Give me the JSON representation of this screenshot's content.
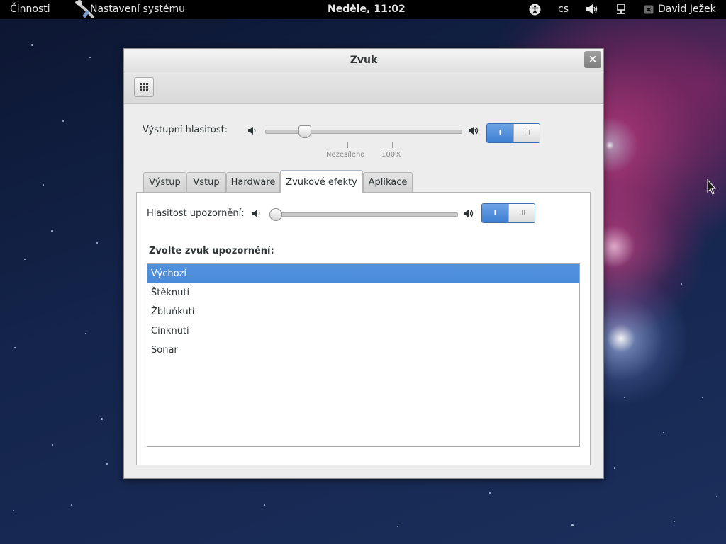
{
  "topbar": {
    "activities": "Činnosti",
    "app_name": "Nastavení systému",
    "clock": "Neděle, 11:02",
    "language": "cs",
    "user": "David Ježek",
    "icons": [
      "accessibility-icon",
      "volume-icon",
      "network-icon",
      "user-status-icon"
    ]
  },
  "window": {
    "title": "Zvuk",
    "close_glyph": "×",
    "toolbar_icon": "all-settings-grid-icon",
    "output_volume": {
      "label": "Výstupní hlasitost:",
      "level_fraction": 0.2,
      "marks": [
        "Nezesíleno",
        "100%"
      ],
      "switch_on": "I",
      "switch_off": "III"
    },
    "tabs": [
      {
        "label": "Výstup",
        "active": false
      },
      {
        "label": "Vstup",
        "active": false
      },
      {
        "label": "Hardware",
        "active": false
      },
      {
        "label": "Zvukové efekty",
        "active": true
      },
      {
        "label": "Aplikace",
        "active": false
      }
    ],
    "effects": {
      "alert_volume_label": "Hlasitost upozornění:",
      "alert_level_fraction": 0.0,
      "switch_on": "I",
      "switch_off": "III",
      "choose_label": "Zvolte zvuk upozornění:",
      "sounds": [
        {
          "label": "Výchozí",
          "selected": true
        },
        {
          "label": "Štěknutí",
          "selected": false
        },
        {
          "label": "Žbluňkutí",
          "selected": false
        },
        {
          "label": "Cinknutí",
          "selected": false
        },
        {
          "label": "Sonar",
          "selected": false
        }
      ]
    }
  },
  "colors": {
    "selection": "#4a8bd9",
    "switch_on": "#3d7fd3",
    "topbar": "#000000"
  }
}
